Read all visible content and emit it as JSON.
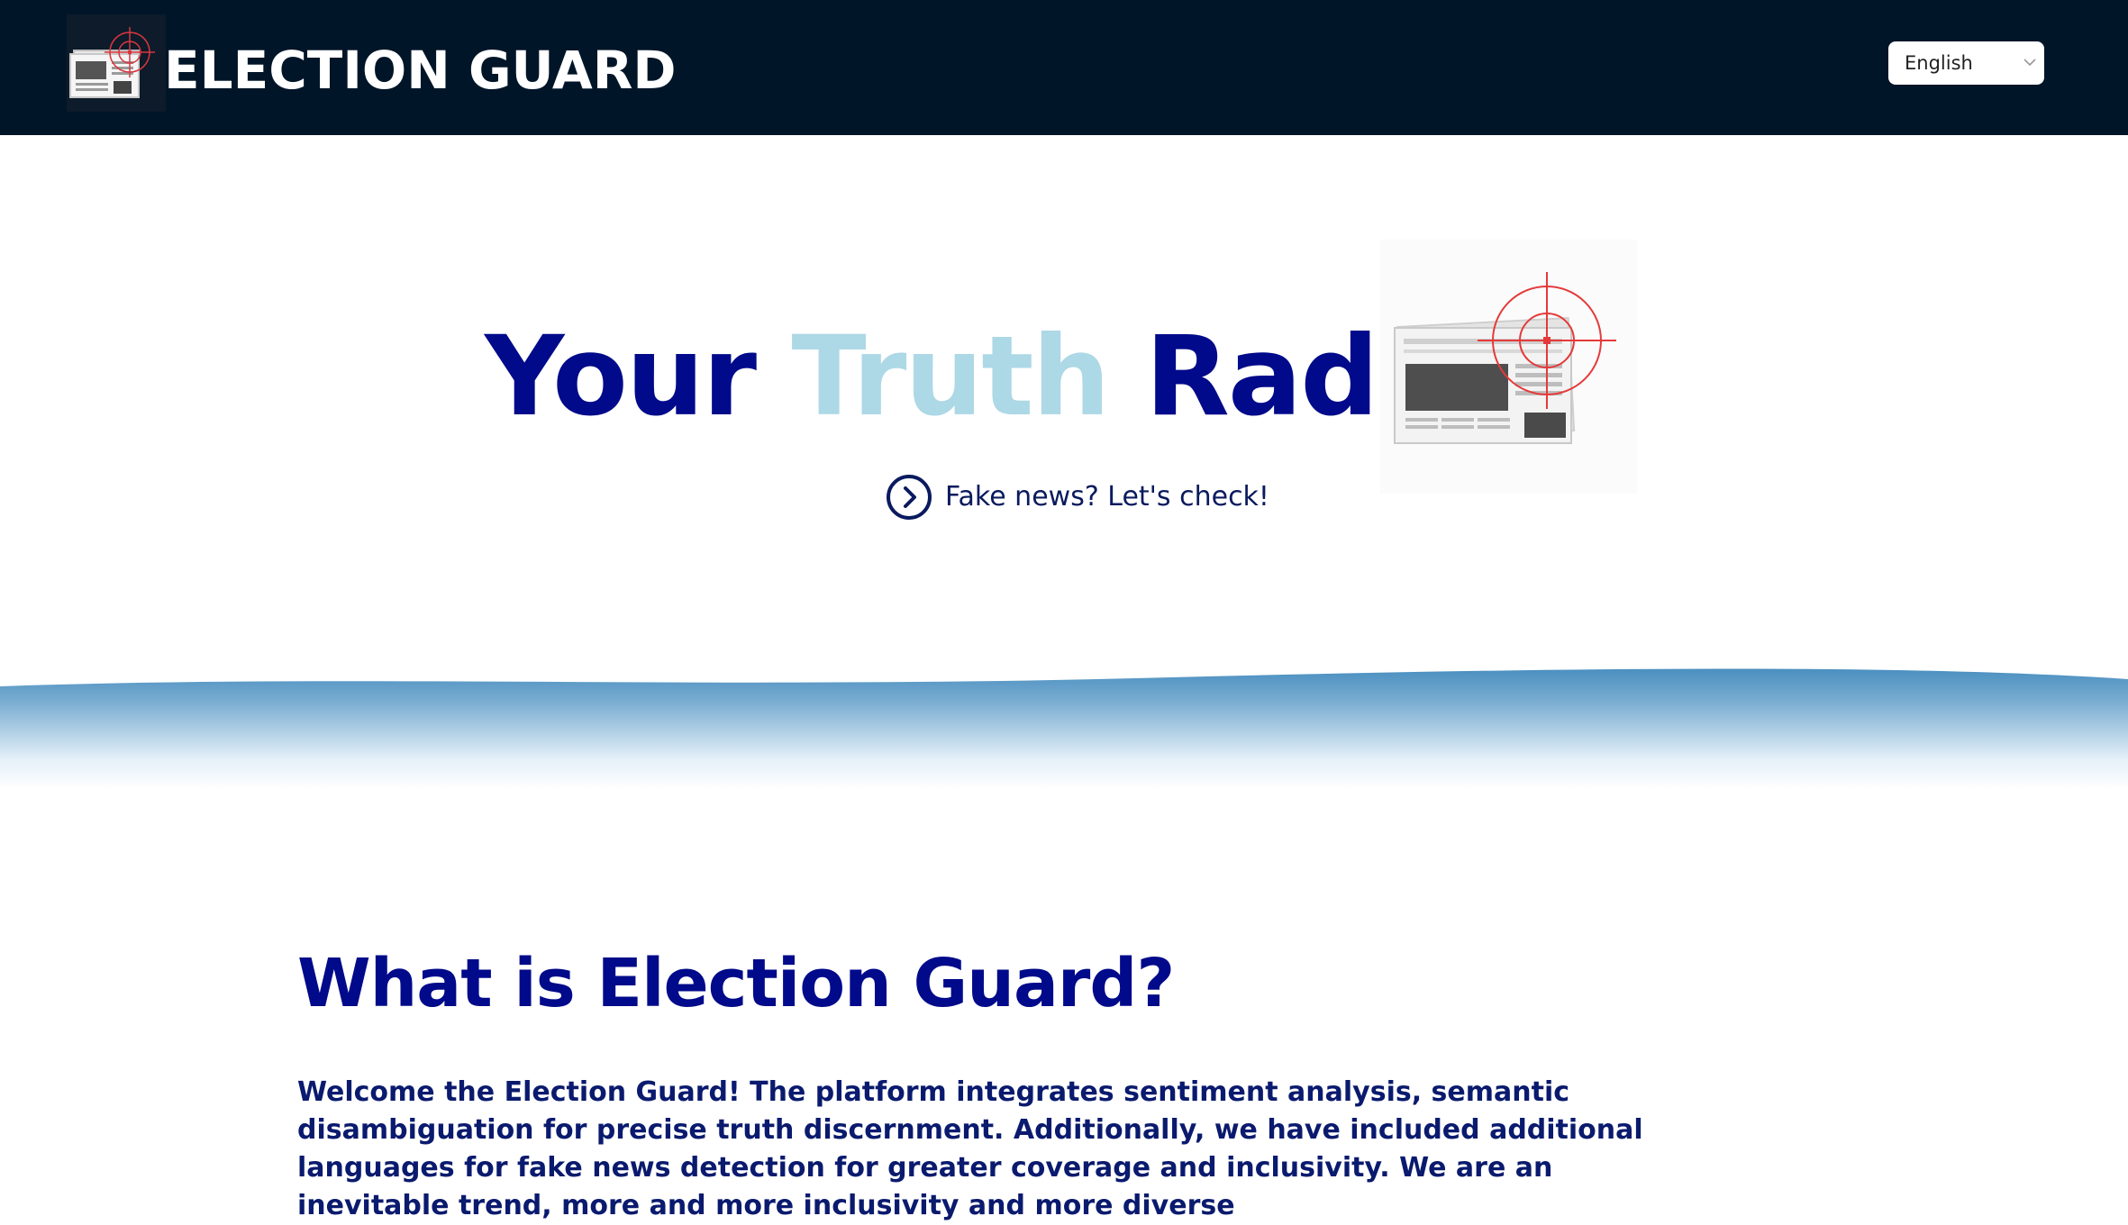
{
  "header": {
    "brand": "ELECTION GUARD",
    "logo_icon": "newspaper-target-icon",
    "language": {
      "selected": "English",
      "icon": "chevron-down-icon"
    },
    "background_color": "#011528"
  },
  "hero": {
    "title_part1": "Your ",
    "title_part2": "Truth",
    "title_part3": " Radar",
    "image_icon": "newspaper-target-icon",
    "cta": {
      "icon": "chevron-right-circle-icon",
      "label": "Fake news? Let's check!"
    },
    "colors": {
      "primary": "#000a8a",
      "accent": "#add8e6",
      "wave": "#4a8fc0"
    }
  },
  "about": {
    "heading": "What is Election Guard?",
    "body": "Welcome the Election Guard! The platform integrates sentiment analysis, semantic disambiguation for precise truth discernment. Additionally, we have included additional languages for fake news detection for greater coverage and inclusivity. We are an inevitable trend, more and more inclusivity and more diverse"
  }
}
